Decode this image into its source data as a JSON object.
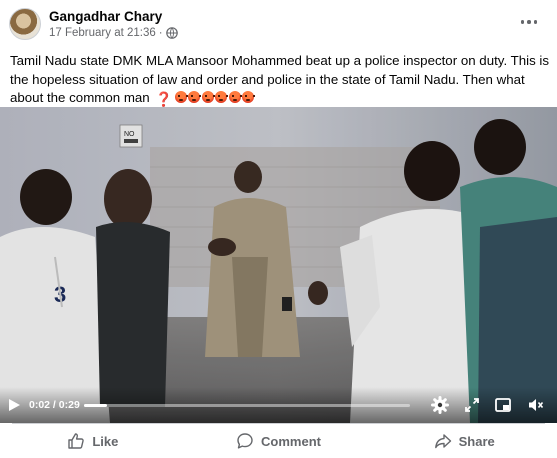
{
  "post": {
    "author": "Gangadhar Chary",
    "timestamp": "17 February at 21:36",
    "separator": "·",
    "privacy_icon": "globe-icon",
    "more_icon": "more-options-icon",
    "caption": "Tamil Nadu state DMK MLA Mansoor Mohammed beat up a police inspector on duty. This is the hopeless situation of law and order and police in the state of Tamil Nadu. Then what about the common man",
    "caption_emoji": {
      "question": "❓",
      "angry_count": 6
    }
  },
  "video": {
    "current_time": "0:02",
    "duration_sep": " / ",
    "duration": "0:29",
    "progress_fraction": 0.07,
    "sign_text": "NO",
    "jersey_number": "3",
    "icons": [
      "play-icon",
      "settings-icon",
      "fullscreen-icon",
      "picture-in-picture-icon",
      "volume-icon"
    ]
  },
  "actions": {
    "like_label": "Like",
    "comment_label": "Comment",
    "share_label": "Share"
  },
  "colors": {
    "secondary_text": "#65676b",
    "divider": "#ced0d4"
  }
}
